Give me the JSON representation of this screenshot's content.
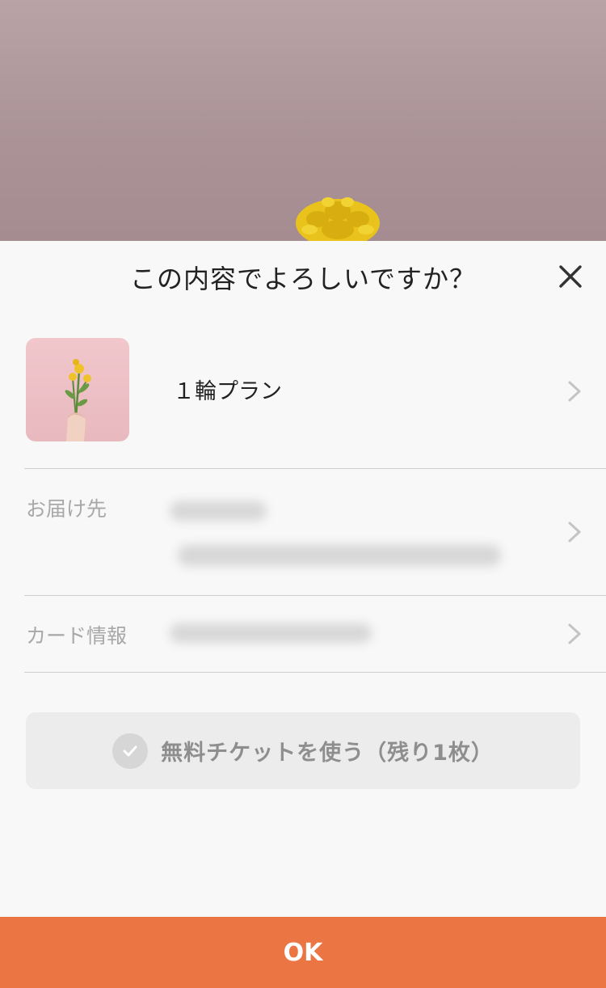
{
  "dialog": {
    "title": "この内容でよろしいですか？"
  },
  "plan": {
    "name": "１輪プラン"
  },
  "address": {
    "label": "お届け先"
  },
  "card": {
    "label": "カード情報"
  },
  "ticket": {
    "label": "無料チケットを使う（残り1枚）"
  },
  "footer": {
    "ok_label": "OK"
  },
  "colors": {
    "accent": "#ec7643",
    "backdrop": "#aa9297"
  }
}
